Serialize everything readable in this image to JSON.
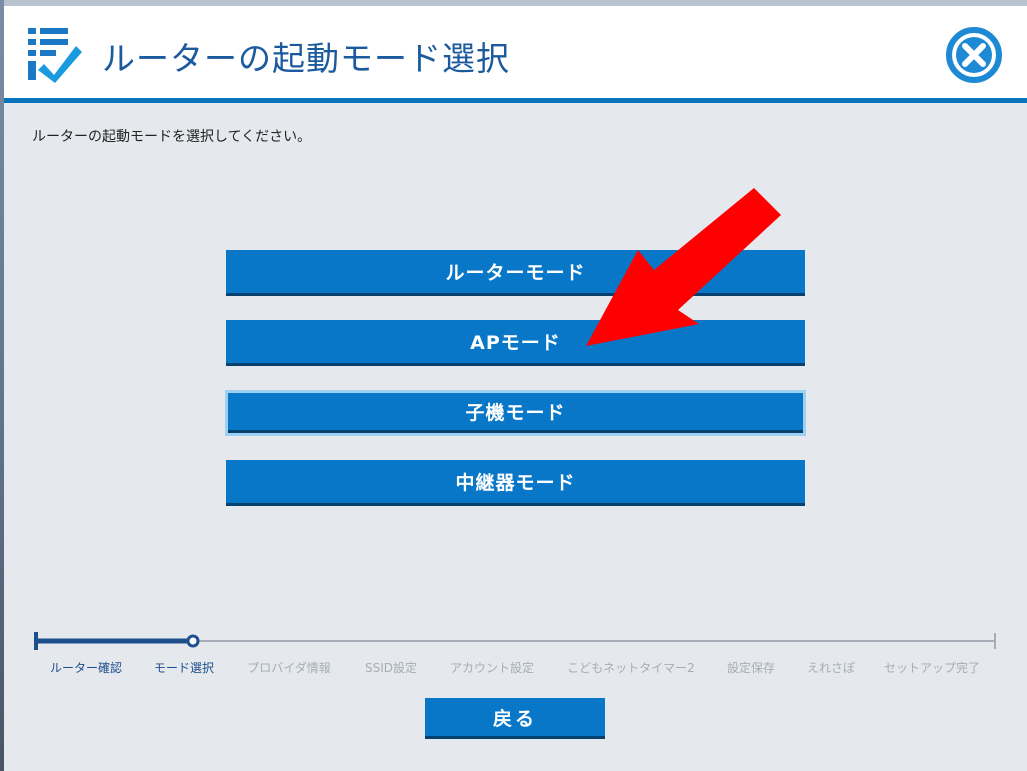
{
  "dialog": {
    "title": "ルーターの起動モード選択",
    "instruction": "ルーターの起動モードを選択してください。"
  },
  "modes": [
    {
      "label": "ルーターモード"
    },
    {
      "label": "APモード"
    },
    {
      "label": "子機モード",
      "selected": true
    },
    {
      "label": "中継器モード"
    }
  ],
  "steps": [
    {
      "label": "ルーター確認",
      "state": "done"
    },
    {
      "label": "モード選択",
      "state": "current"
    },
    {
      "label": "プロバイダ情報",
      "state": "pending"
    },
    {
      "label": "SSID設定",
      "state": "pending"
    },
    {
      "label": "アカウント設定",
      "state": "pending"
    },
    {
      "label": "こどもネットタイマー2",
      "state": "pending"
    },
    {
      "label": "設定保存",
      "state": "pending"
    },
    {
      "label": "えれさぽ",
      "state": "pending"
    },
    {
      "label": "セットアップ完了",
      "state": "pending"
    }
  ],
  "back_label": "戻る",
  "colors": {
    "accent": "#0977c7",
    "header_rule": "#0a73bd",
    "progress_done": "#1c4f8c",
    "close_icon": "#1e8ad6",
    "annotation_arrow": "#ff0000"
  },
  "icons": {
    "header": "checklist-icon",
    "close": "close-icon",
    "annotation": "red-arrow"
  }
}
